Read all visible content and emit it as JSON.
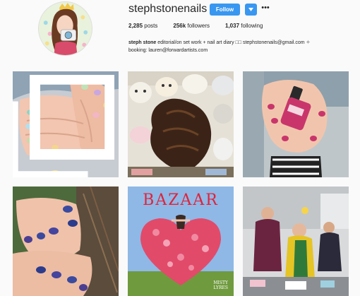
{
  "profile": {
    "username": "stephstonenails",
    "follow_label": "Follow",
    "more_label": "•••"
  },
  "stats": {
    "posts_count": "2,285",
    "posts_label": "posts",
    "followers_count": "256k",
    "followers_label": "followers",
    "following_count": "1,037",
    "following_label": "following"
  },
  "bio": {
    "name": "steph stone",
    "line1": "editorial/on set work + nail art diary □□ stephstonenails@gmail.com ✧",
    "line2": "booking: lauren@forwardartists.com"
  },
  "posts": [
    {
      "id": "post-1",
      "subject": "nail-art-hands",
      "multi": true
    },
    {
      "id": "post-2",
      "subject": "plush-toys-hair"
    },
    {
      "id": "post-3",
      "subject": "nail-polish-bottle"
    },
    {
      "id": "post-4",
      "subject": "metallic-nails"
    },
    {
      "id": "post-5",
      "subject": "magazine-cover",
      "magazine_title": "BAZAAR",
      "magazine_sub1": "MISTY",
      "magazine_sub2": "LYRES"
    },
    {
      "id": "post-6",
      "subject": "on-set-photo"
    }
  ],
  "colors": {
    "accent": "#3897f0",
    "text": "#262626",
    "background": "#fafafa"
  }
}
